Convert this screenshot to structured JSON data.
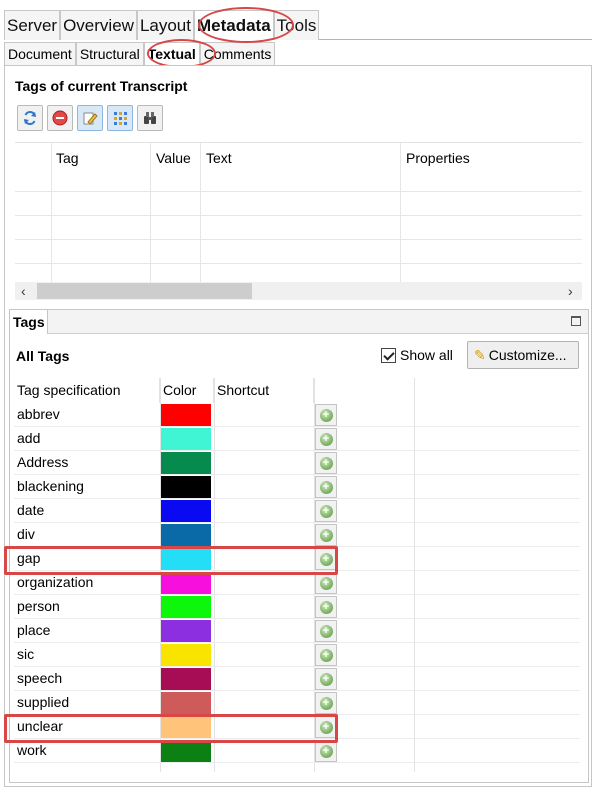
{
  "main_tabs": [
    "Server",
    "Overview",
    "Layout",
    "Metadata",
    "Tools"
  ],
  "sub_tabs": [
    "Document",
    "Structural",
    "Textual",
    "Comments"
  ],
  "transcript_section": {
    "title": "Tags of current Transcript",
    "toolbar_icons": [
      "refresh-icon",
      "delete-icon",
      "edit-icon",
      "grid-icon",
      "binoculars-icon"
    ],
    "columns": [
      "Tag",
      "Value",
      "Text",
      "Properties"
    ]
  },
  "tags_view": {
    "tab_label": "Tags",
    "heading": "All Tags",
    "show_all_label": "Show all",
    "show_all_checked": true,
    "customize_label": "Customize...",
    "columns": [
      "Tag specification",
      "Color",
      "Shortcut"
    ],
    "tags": [
      {
        "name": "abbrev",
        "color": "#ff0000"
      },
      {
        "name": "add",
        "color": "#3ff5d3"
      },
      {
        "name": "Address",
        "color": "#078a4e"
      },
      {
        "name": "blackening",
        "color": "#000000"
      },
      {
        "name": "date",
        "color": "#0a0af2"
      },
      {
        "name": "div",
        "color": "#0a6aa8"
      },
      {
        "name": "gap",
        "color": "#24def7"
      },
      {
        "name": "organization",
        "color": "#f70fdd"
      },
      {
        "name": "person",
        "color": "#0cf70c"
      },
      {
        "name": "place",
        "color": "#8b2fe0"
      },
      {
        "name": "sic",
        "color": "#f9e400"
      },
      {
        "name": "speech",
        "color": "#a60d55"
      },
      {
        "name": "supplied",
        "color": "#cf5a5a"
      },
      {
        "name": "unclear",
        "color": "#ffc47a"
      },
      {
        "name": "work",
        "color": "#0d8014"
      }
    ]
  },
  "highlight_color": "#d84646"
}
